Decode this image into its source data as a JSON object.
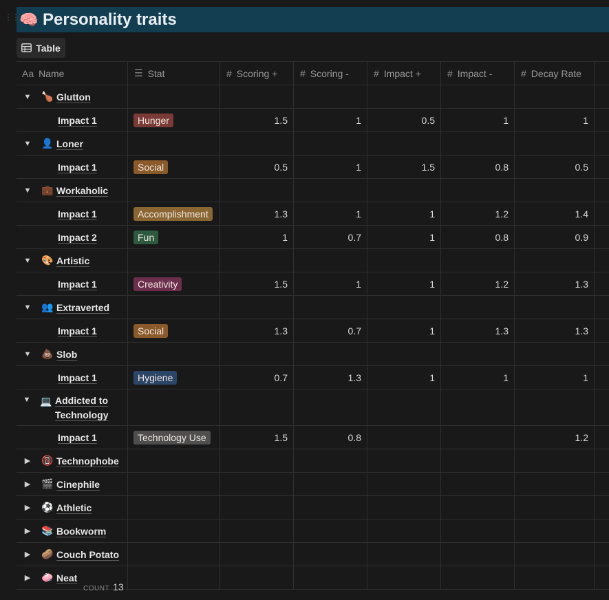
{
  "page": {
    "title": "Personality traits",
    "title_emoji": "🧠",
    "bar_color": "#133e52"
  },
  "view": {
    "label": "Table",
    "icon": "table-icon"
  },
  "columns": {
    "name": "Name",
    "stat": "Stat",
    "scoring_plus": "Scoring +",
    "scoring_minus": "Scoring -",
    "impact_plus": "Impact +",
    "impact_minus": "Impact -",
    "decay_rate": "Decay Rate"
  },
  "tag_colors": {
    "Hunger": "#7a3a35",
    "Social": "#8a5a2b",
    "Accomplishment": "#8a6633",
    "Fun": "#2d5a3f",
    "Creativity": "#6b2f4d",
    "Hygiene": "#2b4566",
    "Technology Use": "#4e4e4e"
  },
  "groups": [
    {
      "name": "Glutton",
      "emoji": "🍗",
      "expanded": true,
      "rows": [
        {
          "name": "Impact 1",
          "stat": "Hunger",
          "scoring_plus": "1.5",
          "scoring_minus": "1",
          "impact_plus": "0.5",
          "impact_minus": "1",
          "decay_rate": "1"
        }
      ]
    },
    {
      "name": "Loner",
      "emoji": "👤",
      "expanded": true,
      "rows": [
        {
          "name": "Impact 1",
          "stat": "Social",
          "scoring_plus": "0.5",
          "scoring_minus": "1",
          "impact_plus": "1.5",
          "impact_minus": "0.8",
          "decay_rate": "0.5"
        }
      ]
    },
    {
      "name": "Workaholic",
      "emoji": "💼",
      "expanded": true,
      "rows": [
        {
          "name": "Impact 1",
          "stat": "Accomplishment",
          "scoring_plus": "1.3",
          "scoring_minus": "1",
          "impact_plus": "1",
          "impact_minus": "1.2",
          "decay_rate": "1.4"
        },
        {
          "name": "Impact 2",
          "stat": "Fun",
          "scoring_plus": "1",
          "scoring_minus": "0.7",
          "impact_plus": "1",
          "impact_minus": "0.8",
          "decay_rate": "0.9"
        }
      ]
    },
    {
      "name": "Artistic",
      "emoji": "🎨",
      "expanded": true,
      "rows": [
        {
          "name": "Impact 1",
          "stat": "Creativity",
          "scoring_plus": "1.5",
          "scoring_minus": "1",
          "impact_plus": "1",
          "impact_minus": "1.2",
          "decay_rate": "1.3"
        }
      ]
    },
    {
      "name": "Extraverted",
      "emoji": "👥",
      "expanded": true,
      "rows": [
        {
          "name": "Impact 1",
          "stat": "Social",
          "scoring_plus": "1.3",
          "scoring_minus": "0.7",
          "impact_plus": "1",
          "impact_minus": "1.3",
          "decay_rate": "1.3"
        }
      ]
    },
    {
      "name": "Slob",
      "emoji": "💩",
      "expanded": true,
      "rows": [
        {
          "name": "Impact 1",
          "stat": "Hygiene",
          "scoring_plus": "0.7",
          "scoring_minus": "1.3",
          "impact_plus": "1",
          "impact_minus": "1",
          "decay_rate": "1"
        }
      ]
    },
    {
      "name": "Addicted to Technology",
      "emoji": "💻",
      "expanded": true,
      "rows": [
        {
          "name": "Impact 1",
          "stat": "Technology Use",
          "scoring_plus": "1.5",
          "scoring_minus": "0.8",
          "impact_plus": "",
          "impact_minus": "",
          "decay_rate": "1.2"
        }
      ]
    },
    {
      "name": "Technophobe",
      "emoji": "📵",
      "expanded": false,
      "rows": []
    },
    {
      "name": "Cinephile",
      "emoji": "🎬",
      "expanded": false,
      "rows": []
    },
    {
      "name": "Athletic",
      "emoji": "⚽",
      "expanded": false,
      "rows": []
    },
    {
      "name": "Bookworm",
      "emoji": "📚",
      "expanded": false,
      "rows": []
    },
    {
      "name": "Couch Potato",
      "emoji": "🥔",
      "expanded": false,
      "rows": []
    },
    {
      "name": "Neat",
      "emoji": "🧼",
      "expanded": false,
      "rows": []
    }
  ],
  "footer": {
    "count_label": "COUNT",
    "count_value": "13"
  }
}
